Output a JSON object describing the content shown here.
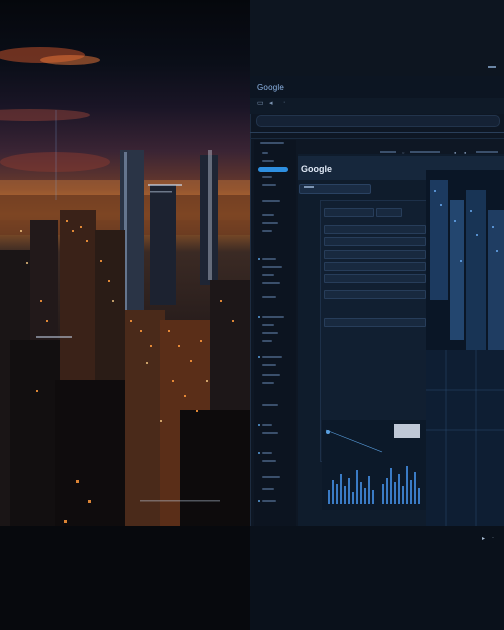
{
  "browser": {
    "brand": "Google"
  },
  "content": {
    "logo": "Google"
  }
}
